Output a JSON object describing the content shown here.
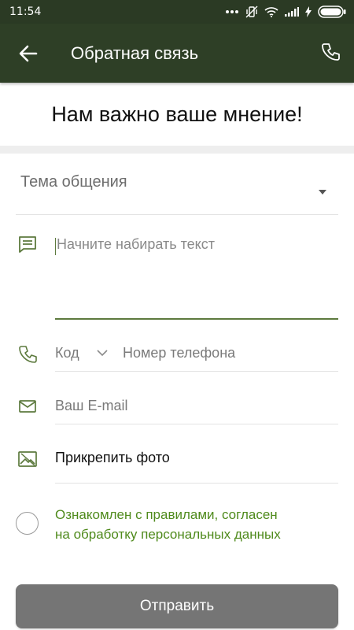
{
  "status_bar": {
    "time": "11:54",
    "icons": [
      "dots-icon",
      "muted-vibrate-icon",
      "wifi-icon",
      "signal-icon",
      "charging-icon",
      "battery-icon"
    ]
  },
  "toolbar": {
    "back_icon": "arrow-left-icon",
    "title": "Обратная связь",
    "action_icon": "phone-icon"
  },
  "heading": "Нам важно ваше мнение!",
  "form": {
    "topic": {
      "placeholder": "Тема общения",
      "icon": "dropdown-arrow-icon"
    },
    "message": {
      "placeholder": "Начните набирать текст",
      "icon": "message-icon"
    },
    "phone": {
      "code_label": "Код",
      "number_placeholder": "Номер телефона",
      "icon": "phone-icon"
    },
    "email": {
      "placeholder": "Ваш E-mail",
      "icon": "mail-icon"
    },
    "photo": {
      "label": "Прикрепить фото",
      "icon": "image-icon"
    },
    "agreement": {
      "line1": "Ознакомлен с правилами, согласен",
      "line2": "на обработку персональных данных",
      "checked": false
    },
    "submit_label": "Отправить"
  },
  "colors": {
    "toolbar": "#2e3f26",
    "accent": "#5d7a3e",
    "agreement_text": "#4f8a1c",
    "submit_button": "#757575"
  }
}
